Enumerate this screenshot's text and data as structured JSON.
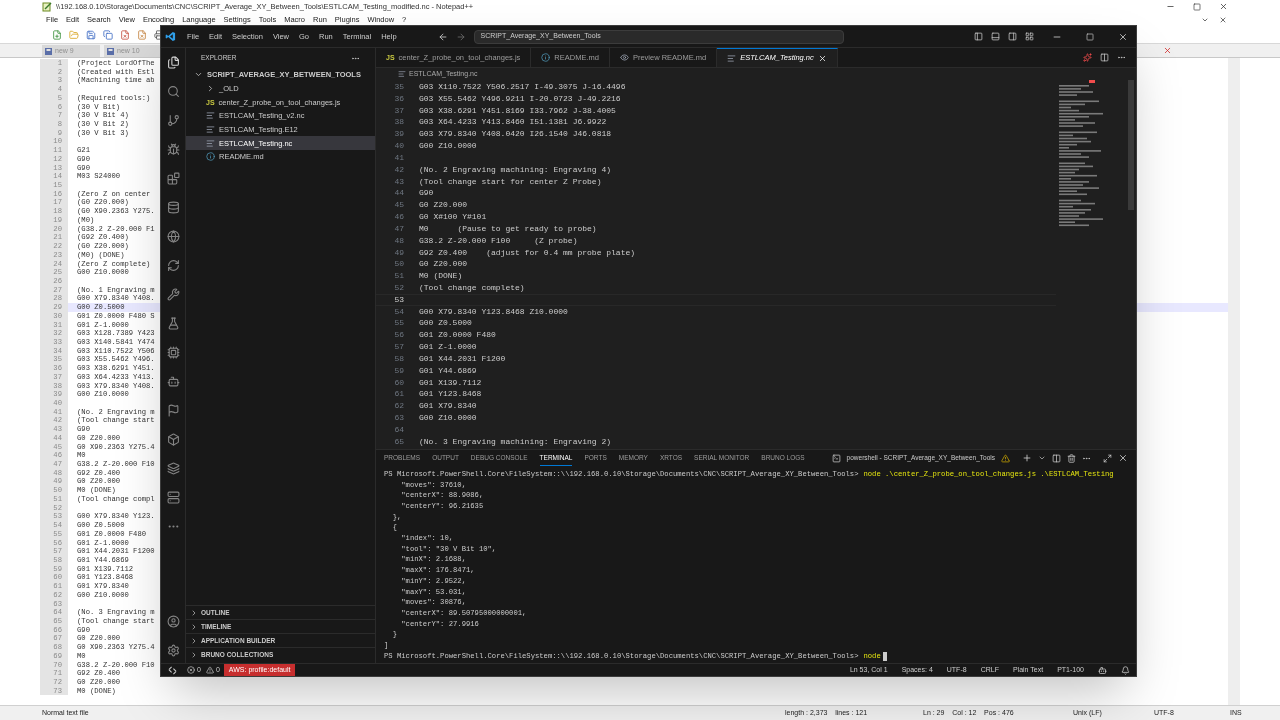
{
  "notepad": {
    "title": "\\\\192.168.0.10\\Storage\\Documents\\CNC\\SCRIPT_Average_XY_Between_Tools\\ESTLCAM_Testing_modified.nc - Notepad++",
    "menu": [
      "File",
      "Edit",
      "Search",
      "View",
      "Encoding",
      "Language",
      "Settings",
      "Tools",
      "Macro",
      "Run",
      "Plugins",
      "Window",
      "?"
    ],
    "tabs": [
      {
        "label": "new 9",
        "selected": false
      },
      {
        "label": "new 10",
        "selected": false
      }
    ],
    "lines": [
      {
        "number": "1",
        "text": "(Project LordOfThe",
        "current": false
      },
      {
        "number": "2",
        "text": "(Created with Estl",
        "current": false
      },
      {
        "number": "3",
        "text": "(Machining time ab",
        "current": false
      },
      {
        "number": "4",
        "current": false
      },
      {
        "number": "5",
        "text": "(Required tools:)",
        "current": false
      },
      {
        "number": "6",
        "text": "(30 V Bit)",
        "current": false
      },
      {
        "number": "7",
        "text": "(30 V Bit 4)",
        "current": false
      },
      {
        "number": "8",
        "text": "(30 V Bit 2)",
        "current": false
      },
      {
        "number": "9",
        "text": "(30 V Bit 3)",
        "current": false
      },
      {
        "number": "10",
        "current": false
      },
      {
        "number": "11",
        "text": "G21",
        "current": false
      },
      {
        "number": "12",
        "text": "G90",
        "current": false
      },
      {
        "number": "13",
        "text": "G90",
        "current": false
      },
      {
        "number": "14",
        "text": "M03 S24000",
        "current": false
      },
      {
        "number": "15",
        "current": false
      },
      {
        "number": "16",
        "text": "(Zero Z on center",
        "current": false
      },
      {
        "number": "17",
        "text": "(G0 Z20.000)",
        "current": false
      },
      {
        "number": "18",
        "text": "(G0 X90.2363 Y275.",
        "current": false
      },
      {
        "number": "19",
        "text": "(M0)",
        "current": false
      },
      {
        "number": "20",
        "text": "(G38.2 Z-20.000 F1",
        "current": false
      },
      {
        "number": "21",
        "text": "(G92 Z0.400)",
        "current": false
      },
      {
        "number": "22",
        "text": "(G0 Z20.000)",
        "current": false
      },
      {
        "number": "23",
        "text": "(M0) (DONE)",
        "current": false
      },
      {
        "number": "24",
        "text": "(Zero Z complete)",
        "current": false
      },
      {
        "number": "25",
        "text": "G00 Z10.0000",
        "current": false
      },
      {
        "number": "26",
        "current": false
      },
      {
        "number": "27",
        "text": "(No. 1 Engraving m",
        "current": false
      },
      {
        "number": "28",
        "text": "G00 X79.8340 Y408.",
        "current": false
      },
      {
        "number": "29",
        "text": "G00 Z0.5000",
        "current": true
      },
      {
        "number": "30",
        "text": "G01 Z0.0000 F480 S",
        "current": false
      },
      {
        "number": "31",
        "text": "G01 Z-1.0000",
        "current": false
      },
      {
        "number": "32",
        "text": "G03 X128.7389 Y423",
        "current": false
      },
      {
        "number": "33",
        "text": "G03 X140.5841 Y474",
        "current": false
      },
      {
        "number": "34",
        "text": "G03 X110.7522 Y506",
        "current": false
      },
      {
        "number": "35",
        "text": "G03 X55.5462 Y496.",
        "current": false
      },
      {
        "number": "36",
        "text": "G03 X38.6291 Y451.",
        "current": false
      },
      {
        "number": "37",
        "text": "G03 X64.4233 Y413.",
        "current": false
      },
      {
        "number": "38",
        "text": "G03 X79.8340 Y408.",
        "current": false
      },
      {
        "number": "39",
        "text": "G00 Z10.0000",
        "current": false
      },
      {
        "number": "40",
        "current": false
      },
      {
        "number": "41",
        "text": "(No. 2 Engraving m",
        "current": false
      },
      {
        "number": "42",
        "text": "(Tool change start",
        "current": false
      },
      {
        "number": "43",
        "text": "G90",
        "current": false
      },
      {
        "number": "44",
        "text": "G0 Z20.000",
        "current": false
      },
      {
        "number": "45",
        "text": "G0 X90.2363 Y275.4",
        "current": false
      },
      {
        "number": "46",
        "text": "M0",
        "current": false
      },
      {
        "number": "47",
        "text": "G38.2 Z-20.000 F10",
        "current": false
      },
      {
        "number": "48",
        "text": "G92 Z0.400",
        "current": false
      },
      {
        "number": "49",
        "text": "G0 Z20.000",
        "current": false
      },
      {
        "number": "50",
        "text": "M0 (DONE)",
        "current": false
      },
      {
        "number": "51",
        "text": "(Tool change compl",
        "current": false
      },
      {
        "number": "52",
        "current": false
      },
      {
        "number": "53",
        "text": "G00 X79.8340 Y123.",
        "current": false
      },
      {
        "number": "54",
        "text": "G00 Z0.5000",
        "current": false
      },
      {
        "number": "55",
        "text": "G01 Z0.0000 F480",
        "current": false
      },
      {
        "number": "56",
        "text": "G01 Z-1.0000",
        "current": false
      },
      {
        "number": "57",
        "text": "G01 X44.2031 F1200",
        "current": false
      },
      {
        "number": "58",
        "text": "G01 Y44.6869",
        "current": false
      },
      {
        "number": "59",
        "text": "G01 X139.7112",
        "current": false
      },
      {
        "number": "60",
        "text": "G01 Y123.8468",
        "current": false
      },
      {
        "number": "61",
        "text": "G01 X79.8340",
        "current": false
      },
      {
        "number": "62",
        "text": "G00 Z10.0000",
        "current": false
      },
      {
        "number": "63",
        "current": false
      },
      {
        "number": "64",
        "text": "(No. 3 Engraving m",
        "current": false
      },
      {
        "number": "65",
        "text": "(Tool change start",
        "current": false
      },
      {
        "number": "66",
        "text": "G90",
        "current": false
      },
      {
        "number": "67",
        "text": "G0 Z20.000",
        "current": false
      },
      {
        "number": "68",
        "text": "G0 X90.2363 Y275.4",
        "current": false
      },
      {
        "number": "69",
        "text": "M0",
        "current": false
      },
      {
        "number": "70",
        "text": "G38.2 Z-20.000 F10",
        "current": false
      },
      {
        "number": "71",
        "text": "G92 Z0.400",
        "current": false
      },
      {
        "number": "72",
        "text": "G0 Z20.000",
        "current": false
      },
      {
        "number": "73",
        "text": "M0 (DONE)",
        "current": false
      }
    ],
    "status_bar": [
      "Normal text file",
      "length : 2,373    lines : 121",
      "Ln : 29    Col : 12    Pos : 476",
      "Unix (LF)",
      "UTF-8",
      "INS"
    ]
  },
  "vscode": {
    "menu": [
      "File",
      "Edit",
      "Selection",
      "View",
      "Go",
      "Run",
      "Terminal",
      "Help"
    ],
    "command_center": "SCRIPT_Average_XY_Between_Tools",
    "explorer": {
      "title": "EXPLORER",
      "root": {
        "label": "SCRIPT_AVERAGE_XY_BETWEEN_TOOLS",
        "kind": "folder",
        "expanded": true,
        "selected": false,
        "children": [
          {
            "label": "_OLD",
            "kind": "folder",
            "expanded": false,
            "selected": false
          },
          {
            "label": "center_Z_probe_on_tool_changes.js",
            "kind": "js",
            "badge": "JS",
            "selected": false
          },
          {
            "label": "ESTLCAM_Testing_v2.nc",
            "kind": "text",
            "selected": false
          },
          {
            "label": "ESTLCAM_Testing.E12",
            "kind": "text",
            "selected": false
          },
          {
            "label": "ESTLCAM_Testing.nc",
            "kind": "text",
            "selected": true
          },
          {
            "label": "README.md",
            "kind": "info",
            "selected": false
          }
        ]
      },
      "sections": [
        {
          "label": "OUTLINE",
          "expanded": false
        },
        {
          "label": "TIMELINE",
          "expanded": false
        },
        {
          "label": "APPLICATION BUILDER",
          "expanded": false
        },
        {
          "label": "BRUNO COLLECTIONS",
          "expanded": false
        }
      ]
    },
    "tabs": [
      {
        "label": "center_Z_probe_on_tool_changes.js",
        "kind": "js",
        "badge": "JS",
        "selected": false
      },
      {
        "label": "README.md",
        "kind": "info",
        "selected": false
      },
      {
        "label": "Preview README.md",
        "kind": "preview",
        "selected": false
      },
      {
        "label": "ESTLCAM_Testing.nc",
        "kind": "text",
        "selected": true
      }
    ],
    "breadcrumb": "ESTLCAM_Testing.nc",
    "editor": {
      "lines": [
        {
          "number": "35",
          "text": "G03 X110.7522 Y506.2517 I-49.3075 J-16.4496",
          "current": false
        },
        {
          "number": "36",
          "text": "G03 X55.5462 Y496.9211 I-20.0723 J-49.2216",
          "current": false
        },
        {
          "number": "37",
          "text": "G03 X38.6291 Y451.8169 I33.7962 J-38.4005",
          "current": false
        },
        {
          "number": "38",
          "text": "G03 X64.4233 Y413.8460 I51.1381 J6.9922",
          "current": false
        },
        {
          "number": "39",
          "text": "G03 X79.8340 Y408.0420 I26.1540 J46.0818",
          "current": false
        },
        {
          "number": "40",
          "text": "G00 Z10.0000",
          "current": false
        },
        {
          "number": "41",
          "current": false
        },
        {
          "number": "42",
          "text": "(No. 2 Engraving machining: Engraving 4)",
          "current": false
        },
        {
          "number": "43",
          "text": "(Tool change start for center Z Probe)",
          "current": false
        },
        {
          "number": "44",
          "text": "G90",
          "current": false
        },
        {
          "number": "45",
          "text": "G0 Z20.000",
          "current": false
        },
        {
          "number": "46",
          "text": "G0 X#100 Y#101",
          "current": false
        },
        {
          "number": "47",
          "text": "M0      (Pause to get ready to probe)",
          "current": false
        },
        {
          "number": "48",
          "text": "G38.2 Z-20.000 F100     (Z probe)",
          "current": false
        },
        {
          "number": "49",
          "text": "G92 Z0.400    (adjust for 0.4 mm probe plate)",
          "current": false
        },
        {
          "number": "50",
          "text": "G0 Z20.000",
          "current": false
        },
        {
          "number": "51",
          "text": "M0 (DONE)",
          "current": false
        },
        {
          "number": "52",
          "text": "(Tool change complete)",
          "current": false
        },
        {
          "number": "53",
          "current": true
        },
        {
          "number": "54",
          "text": "G00 X79.8340 Y123.8468 Z10.0000",
          "current": false
        },
        {
          "number": "55",
          "text": "G00 Z0.5000",
          "current": false
        },
        {
          "number": "56",
          "text": "G01 Z0.0000 F480",
          "current": false
        },
        {
          "number": "57",
          "text": "G01 Z-1.0000",
          "current": false
        },
        {
          "number": "58",
          "text": "G01 X44.2031 F1200",
          "current": false
        },
        {
          "number": "59",
          "text": "G01 Y44.6869",
          "current": false
        },
        {
          "number": "60",
          "text": "G01 X139.7112",
          "current": false
        },
        {
          "number": "61",
          "text": "G01 Y123.8468",
          "current": false
        },
        {
          "number": "62",
          "text": "G01 X79.8340",
          "current": false
        },
        {
          "number": "63",
          "text": "G00 Z10.0000",
          "current": false
        },
        {
          "number": "64",
          "current": false
        },
        {
          "number": "65",
          "text": "(No. 3 Engraving machining: Engraving 2)",
          "current": false
        }
      ]
    },
    "panel": {
      "tabs": [
        {
          "label": "PROBLEMS",
          "selected": false
        },
        {
          "label": "OUTPUT",
          "selected": false
        },
        {
          "label": "DEBUG CONSOLE",
          "selected": false
        },
        {
          "label": "TERMINAL",
          "selected": true
        },
        {
          "label": "PORTS",
          "selected": false
        },
        {
          "label": "MEMORY",
          "selected": false
        },
        {
          "label": "XRTOS",
          "selected": false
        },
        {
          "label": "SERIAL MONITOR",
          "selected": false
        },
        {
          "label": "BRUNO LOGS",
          "selected": false
        }
      ],
      "terminal_title": "powershell - SCRIPT_Average_XY_Between_Tools",
      "terminal": [
        {
          "prompt": "PS Microsoft.PowerShell.Core\\FileSystem::\\\\192.168.0.10\\Storage\\Documents\\CNC\\SCRIPT_Average_XY_Between_Tools>",
          "command": "node .\\center_Z_probe_on_tool_changes.js .\\ESTLCAM_Testing",
          "cursor": false
        },
        {
          "text": "    \"moves\": 37610,"
        },
        {
          "text": "    \"centerX\": 88.9086,"
        },
        {
          "text": "    \"centerY\": 96.21635"
        },
        {
          "text": "  },"
        },
        {
          "text": "  {"
        },
        {
          "text": "    \"index\": 10,"
        },
        {
          "text": "    \"tool\": \"30 V Bit 10\","
        },
        {
          "text": "    \"minX\": 2.1688,"
        },
        {
          "text": "    \"maxX\": 176.8471,"
        },
        {
          "text": "    \"minY\": 2.9522,"
        },
        {
          "text": "    \"maxY\": 53.031,"
        },
        {
          "text": "    \"moves\": 30876,"
        },
        {
          "text": "    \"centerX\": 89.50795000000001,"
        },
        {
          "text": "    \"centerY\": 27.9916"
        },
        {
          "text": "  }"
        },
        {
          "text": "]"
        },
        {
          "prompt": "PS Microsoft.PowerShell.Core\\FileSystem::\\\\192.168.0.10\\Storage\\Documents\\CNC\\SCRIPT_Average_XY_Between_Tools>",
          "command": "node",
          "cursor": true
        }
      ]
    },
    "status_bar": {
      "errors": "0",
      "warnings": "0",
      "aws": "AWS: profile:default",
      "items": [
        "Ln 53, Col 1",
        "Spaces: 4",
        "UTF-8",
        "CRLF",
        "Plain Text",
        "PT1-100"
      ]
    }
  }
}
